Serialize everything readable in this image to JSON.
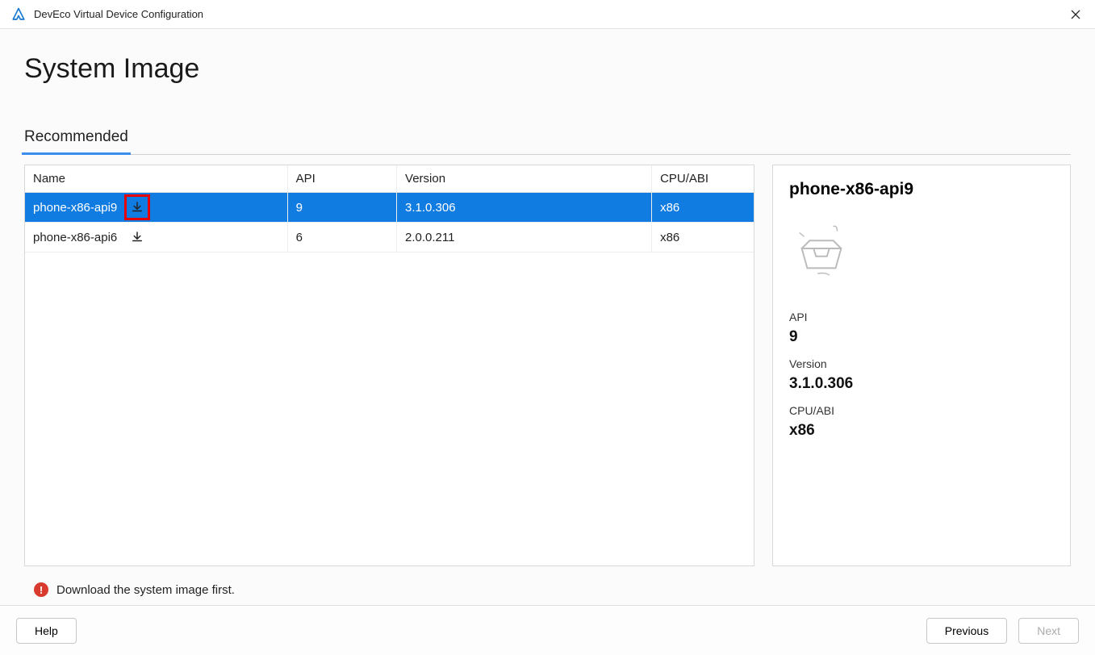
{
  "titlebar": {
    "title": "DevEco Virtual Device Configuration"
  },
  "page": {
    "heading": "System Image"
  },
  "tabs": [
    {
      "label": "Recommended"
    }
  ],
  "table": {
    "headers": {
      "name": "Name",
      "api": "API",
      "version": "Version",
      "cpu": "CPU/ABI"
    },
    "rows": [
      {
        "name": "phone-x86-api9",
        "api": "9",
        "version": "3.1.0.306",
        "cpu": "x86"
      },
      {
        "name": "phone-x86-api6",
        "api": "6",
        "version": "2.0.0.211",
        "cpu": "x86"
      }
    ]
  },
  "detail": {
    "title": "phone-x86-api9",
    "api_label": "API",
    "api_value": "9",
    "version_label": "Version",
    "version_value": "3.1.0.306",
    "cpu_label": "CPU/ABI",
    "cpu_value": "x86"
  },
  "warning": {
    "text": "Download the system image first."
  },
  "footer": {
    "help": "Help",
    "previous": "Previous",
    "next": "Next"
  }
}
